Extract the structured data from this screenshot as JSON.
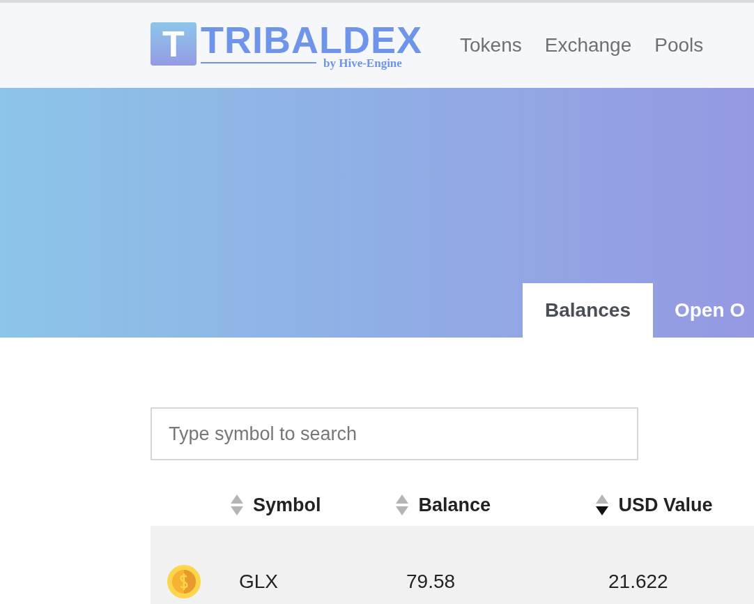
{
  "logo": {
    "letter": "T",
    "name": "TRIBALDEX",
    "tagline": "by Hive-Engine"
  },
  "nav": [
    "Tokens",
    "Exchange",
    "Pools"
  ],
  "tabs": [
    {
      "label": "Balances",
      "selected": true
    },
    {
      "label": "Open O",
      "selected": false
    }
  ],
  "search": {
    "placeholder": "Type symbol to search"
  },
  "table": {
    "columns": [
      {
        "label": "Symbol",
        "sorted": false
      },
      {
        "label": "Balance",
        "sorted": false
      },
      {
        "label": "USD Value",
        "sorted": true
      }
    ],
    "rows": [
      {
        "symbol": "GLX",
        "balance": "79.58",
        "usd_value": "21.622"
      }
    ]
  }
}
